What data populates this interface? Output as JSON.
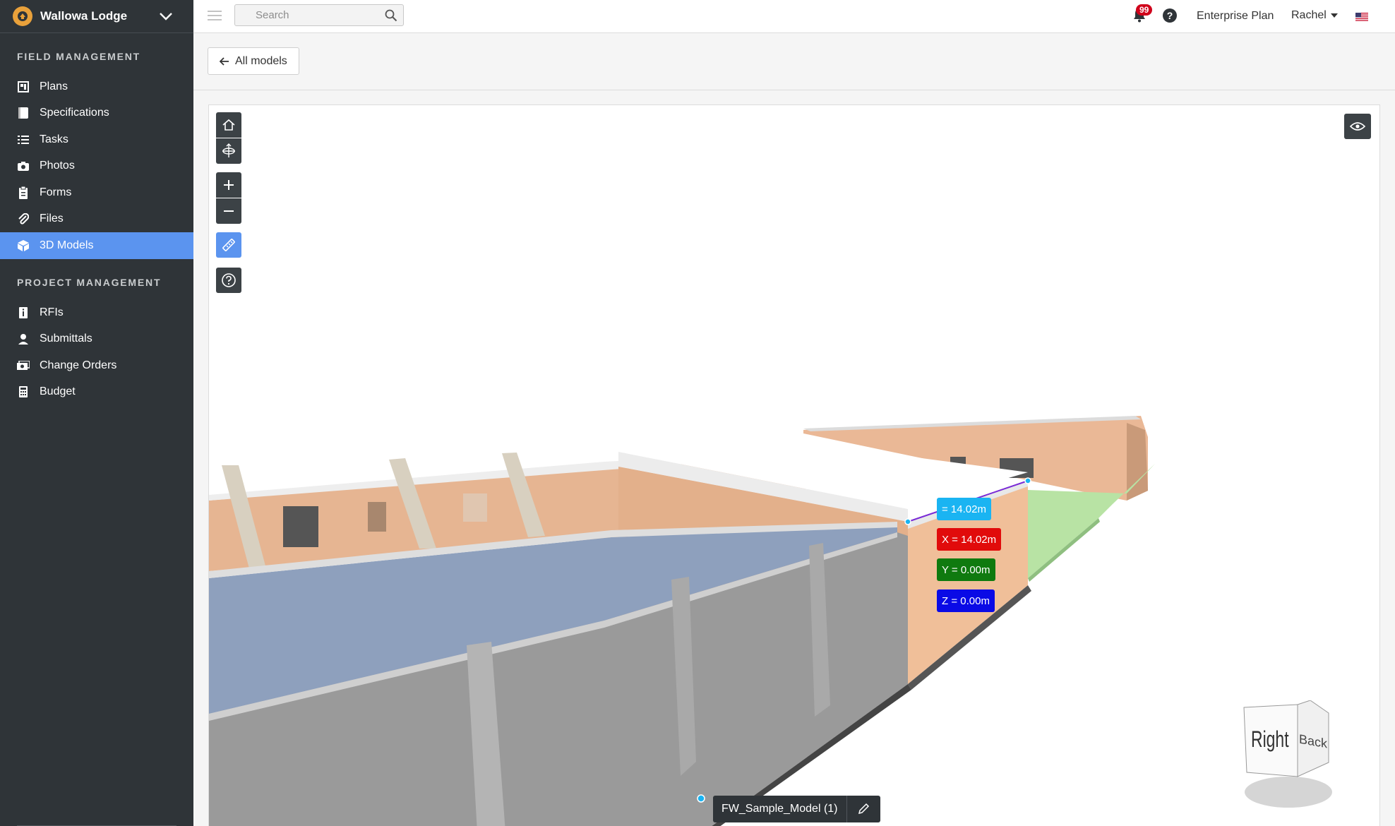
{
  "project": {
    "name": "Wallowa Lodge"
  },
  "sidebar": {
    "field_title": "FIELD MANAGEMENT",
    "field_items": [
      {
        "label": "Plans",
        "icon": "plans-icon"
      },
      {
        "label": "Specifications",
        "icon": "specifications-icon"
      },
      {
        "label": "Tasks",
        "icon": "tasks-icon"
      },
      {
        "label": "Photos",
        "icon": "camera-icon"
      },
      {
        "label": "Forms",
        "icon": "clipboard-icon"
      },
      {
        "label": "Files",
        "icon": "paperclip-icon"
      },
      {
        "label": "3D Models",
        "icon": "cube-icon",
        "active": true
      }
    ],
    "project_title": "PROJECT MANAGEMENT",
    "project_items": [
      {
        "label": "RFIs",
        "icon": "info-doc-icon"
      },
      {
        "label": "Submittals",
        "icon": "person-icon"
      },
      {
        "label": "Change Orders",
        "icon": "money-icon"
      },
      {
        "label": "Budget",
        "icon": "calculator-icon"
      }
    ]
  },
  "topbar": {
    "search_placeholder": "Search",
    "notifications": "99",
    "help": "?",
    "plan": "Enterprise Plan",
    "user": "Rachel"
  },
  "subheader": {
    "back_label": "All models"
  },
  "viewer": {
    "measurements": {
      "total": "= 14.02m",
      "x": "X = 14.02m",
      "y": "Y = 0.00m",
      "z": "Z = 0.00m"
    },
    "model_name": "FW_Sample_Model (1)",
    "viewcube": {
      "face_right": "Right",
      "face_back": "Back"
    }
  },
  "colors": {
    "sidebar_bg": "#2f3438",
    "accent": "#5b94ef",
    "measure_total": "#1ab4f2",
    "measure_x": "#e10b0b",
    "measure_y": "#0f7a0f",
    "measure_z": "#0a0ae6",
    "badge": "#d0021b"
  }
}
